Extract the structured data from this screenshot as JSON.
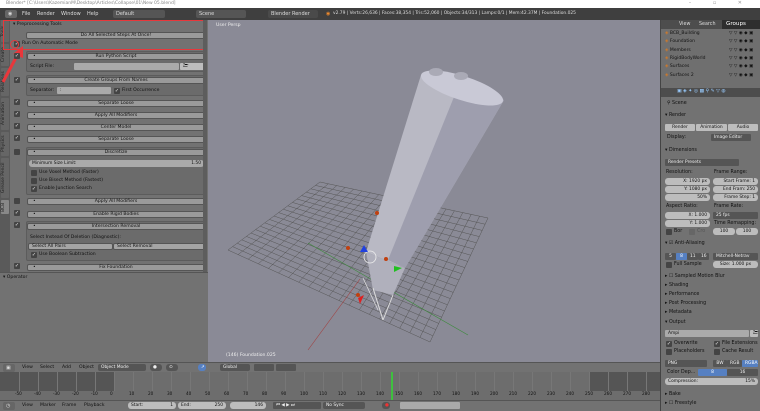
{
  "window": {
    "title": "Blender* [C:\\Users\\KazemianM\\Desktop\\Articles\\Collapse\\01\\New 05.blend]",
    "controls": "– ▫ ✕"
  },
  "infobar": {
    "menus": [
      "File",
      "Render",
      "Window",
      "Help"
    ],
    "layout": "Default",
    "scene": "Scene",
    "engine": "Blender Render",
    "stats": "v2.79 | Verts:26,636 | Faces:38,354 | Tris:52,060 | Objects:34/313 | Lamps:0/1 | Mem:42.37M | Foundation.025"
  },
  "tabs": [
    "Tools",
    "Create",
    "Relations",
    "Animation",
    "Physics",
    "Grease Pencil",
    "BCB"
  ],
  "tools": {
    "panel_title": "Preprocessing Tools",
    "do_all": "Do All Selected Steps At Once!",
    "auto_mode": "Run On Automatic Mode",
    "run_python": "Run Python Script",
    "script_file_label": "Script File:",
    "script_file_value": "",
    "create_groups": "Create Groups From Names",
    "separator_label": "Separator:",
    "separator_value": ":",
    "first_occurrence": "First Occurrence",
    "separate_loose": "Separate Loose",
    "apply_modifiers": "Apply All Modifiers",
    "center_model": "Center Model",
    "separate_loose2": "Separate Loose",
    "discretize": "Discretize",
    "min_size_label": "Minimum Size Limit:",
    "min_size_value": "1.50",
    "voxel": "Use Voxel Method (Faster)",
    "bisect": "Use Bisect Method (Fastest)",
    "junction": "Enable Junction Search",
    "apply_modifiers2": "Apply All Modifiers",
    "rigid": "Enable Rigid Bodies",
    "intersection": "Intersection Removal",
    "select_instead": "Select Instead Of Deletion (Diagnostic):",
    "select_all_pairs": "Select All Pairs",
    "select_removal": "Select Removal",
    "boolean": "Use Boolean Subtraction",
    "fix_foundation": "Fix Foundation",
    "operator": "Operator"
  },
  "viewport": {
    "label": "User Persp",
    "object_label": "(146) Foundation.025"
  },
  "view3d_header": {
    "menus": [
      "View",
      "Select",
      "Add",
      "Object"
    ],
    "mode": "Object Mode",
    "orientation": "Global"
  },
  "timeline": {
    "ticks": [
      "-50",
      "-40",
      "-30",
      "-20",
      "-10",
      "0",
      "10",
      "20",
      "30",
      "40",
      "50",
      "60",
      "70",
      "80",
      "90",
      "100",
      "110",
      "120",
      "130",
      "140",
      "150",
      "160",
      "170",
      "180",
      "190",
      "200",
      "210",
      "220",
      "230",
      "240",
      "250",
      "260",
      "270",
      "280"
    ],
    "current_frame": 146,
    "start": "1",
    "end": "250",
    "frame": "146",
    "menus": [
      "View",
      "Marker",
      "Frame",
      "Playback"
    ],
    "start_label": "Start:",
    "end_label": "End:",
    "sync": "No Sync"
  },
  "outliner": {
    "tabs": [
      "View",
      "Search",
      "Groups"
    ],
    "items": [
      "BCB_Building",
      "Foundation",
      "Members",
      "RigidBodyWorld",
      "Surfaces",
      "Surfaces 2"
    ]
  },
  "properties": {
    "scene": "Scene",
    "render": "Render",
    "render_btn": "Render",
    "animation_btn": "Animation",
    "audio_btn": "Audio",
    "display_label": "Display:",
    "display_value": "Image Editor",
    "dimensions": "Dimensions",
    "presets": "Render Presets",
    "resolution": "Resolution:",
    "res_x": "X:   1920 px",
    "res_y": "Y:   1080 px",
    "res_pct": "50%",
    "frame_range": "Frame Range:",
    "start_frame": "Start Frame: 1",
    "end_frame": "End Fram: 250",
    "frame_step": "Frame Step: 1",
    "aspect": "Aspect Ratio:",
    "asp_x": "X:   1.000",
    "asp_y": "Y:   1.000",
    "bor": "Bor",
    "cro": "Cro",
    "frame_rate": "Frame Rate:",
    "fps": "25 fps",
    "time_remap": "Time Remapping:",
    "remap_old": "100",
    "remap_new": "100",
    "aa": "Anti-Aliasing",
    "aa_samples": [
      "5",
      "8",
      "11",
      "16"
    ],
    "filter": "Mitchell-Netrav",
    "full_sample": "Full Sample",
    "size": "Size: 1.000 px",
    "collapsed": [
      "Sampled Motion Blur",
      "Shading",
      "Performance",
      "Post Processing",
      "Metadata"
    ],
    "output": "Output",
    "output_path": "Ampi",
    "overwrite": "Overwrite",
    "file_ext": "File Extensions",
    "placeholders": "Placeholders",
    "cache": "Cache Result",
    "format": "PNG",
    "bw": "BW",
    "rgb": "RGB",
    "rgba": "RGBA",
    "color_depth": "Color Dep...",
    "depth8": "8",
    "depth16": "16",
    "compression": "Compression:",
    "compression_value": "15%",
    "bake": "Bake",
    "freestyle": "Freestyle"
  },
  "colors": {
    "highlight": "#e8373b",
    "accent": "#5680c2",
    "current_frame": "#3fbf3f"
  }
}
